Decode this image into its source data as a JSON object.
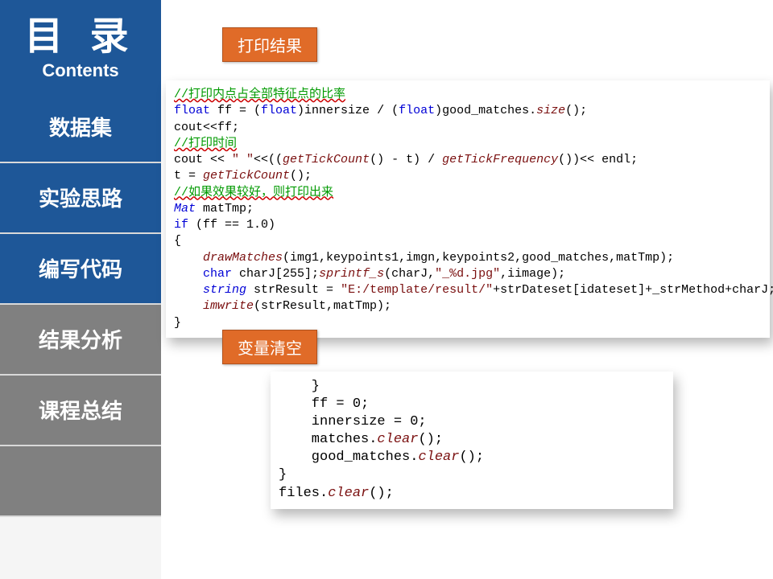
{
  "sidebar": {
    "title": "目 录",
    "subtitle": "Contents",
    "items": [
      {
        "label": "数据集",
        "style": "blue"
      },
      {
        "label": "实验思路",
        "style": "blue"
      },
      {
        "label": "编写代码",
        "style": "blue"
      },
      {
        "label": "结果分析",
        "style": "gray"
      },
      {
        "label": "课程总结",
        "style": "gray"
      }
    ]
  },
  "badges": {
    "print_result": "打印结果",
    "clear_vars": "变量清空"
  },
  "code1": {
    "c01": "//打印内点占全部特征点的比率",
    "c02a": "float",
    "c02b": " ff = (",
    "c02c": "float",
    "c02d": ")innersize / (",
    "c02e": "float",
    "c02f": ")good_matches.",
    "c02g": "size",
    "c02h": "();",
    "c03": "cout<<ff;",
    "c04": "//打印时间",
    "c05a": "cout << ",
    "c05b": "\" \"",
    "c05c": "<<((",
    "c05d": "getTickCount",
    "c05e": "() - t) / ",
    "c05f": "getTickFrequency",
    "c05g": "())<< endl;",
    "c06a": "t = ",
    "c06b": "getTickCount",
    "c06c": "();",
    "c07": "//如果效果较好，则打印出来",
    "c08a": "Mat",
    "c08b": " matTmp;",
    "c09a": "if",
    "c09b": " (ff == 1.0)",
    "c10": "{",
    "c11a": "    ",
    "c11b": "drawMatches",
    "c11c": "(img1,keypoints1,imgn,keypoints2,good_matches,matTmp);",
    "c12a": "    ",
    "c12b": "char",
    "c12c": " charJ[255];",
    "c12d": "sprintf_s",
    "c12e": "(charJ,",
    "c12f": "\"_%d.jpg\"",
    "c12g": ",iimage);",
    "c13a": "    ",
    "c13b": "string",
    "c13c": " strResult = ",
    "c13d": "\"E:/template/result/\"",
    "c13e": "+strDateset[idateset]+_strMethod+charJ;",
    "c14a": "    ",
    "c14b": "imwrite",
    "c14c": "(strResult,matTmp);",
    "c15": "}"
  },
  "code2": {
    "l1": "    }",
    "l2": "    ff = 0;",
    "l3": "    innersize = 0;",
    "l4a": "    matches.",
    "l4b": "clear",
    "l4c": "();",
    "l5a": "    good_matches.",
    "l5b": "clear",
    "l5c": "();",
    "l6": "}",
    "l7a": "files.",
    "l7b": "clear",
    "l7c": "();"
  }
}
